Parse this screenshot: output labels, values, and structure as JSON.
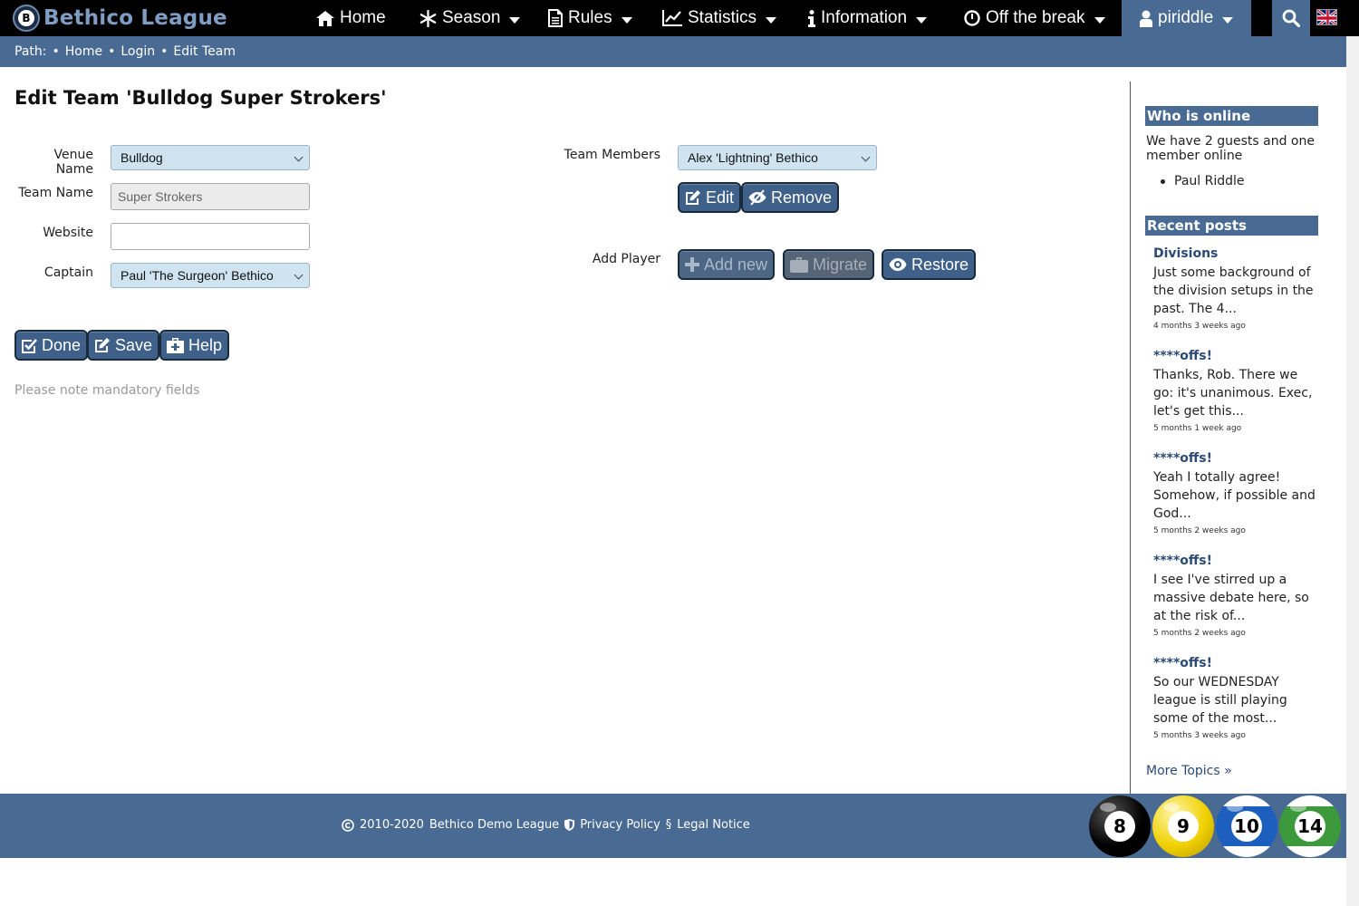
{
  "brand": {
    "name": "Bethico League",
    "ball_letter": "B"
  },
  "nav": {
    "home": "Home",
    "season": "Season",
    "rules": "Rules",
    "statistics": "Statistics",
    "information": "Information",
    "off_the_break": "Off the break",
    "user": "piriddle"
  },
  "breadcrumb": {
    "label": "Path:",
    "items": [
      "Home",
      "Login",
      "Edit Team"
    ],
    "separator": "•"
  },
  "page": {
    "title": "Edit Team 'Bulldog Super Strokers'",
    "note": "Please note mandatory fields"
  },
  "form": {
    "venue_label": "Venue Name",
    "venue_value": "Bulldog",
    "team_label": "Team Name",
    "team_value": "Super Strokers",
    "website_label": "Website",
    "website_value": "",
    "captain_label": "Captain",
    "captain_value": "Paul 'The Surgeon' Bethico",
    "members_label": "Team Members",
    "members_value": "Alex 'Lightning' Bethico",
    "add_player_label": "Add Player"
  },
  "buttons": {
    "edit": "Edit",
    "remove": "Remove",
    "add_new": "Add new",
    "migrate": "Migrate",
    "restore": "Restore",
    "done": "Done",
    "save": "Save",
    "help": "Help"
  },
  "sidebar": {
    "online_title": "Who is online",
    "online_text": "We have 2 guests and one member online",
    "online_members": [
      "Paul Riddle"
    ],
    "posts_title": "Recent posts",
    "posts": [
      {
        "title": "Divisions",
        "body": "Just some background of the division setups in the past. The 4...",
        "time": "4 months 3 weeks ago"
      },
      {
        "title": "****offs!",
        "body": "Thanks, Rob. There we go: it's unanimous. Exec, let's get this...",
        "time": "5 months 1 week ago"
      },
      {
        "title": "****offs!",
        "body": "Yeah I totally agree! Somehow, if possible and God...",
        "time": "5 months 2 weeks ago"
      },
      {
        "title": "****offs!",
        "body": "I see I've stirred up a massive debate here, so at the risk of...",
        "time": "5 months 2 weeks ago"
      },
      {
        "title": "****offs!",
        "body": "So our WEDNESDAY league is still playing some of the most...",
        "time": "5 months 3 weeks ago"
      }
    ],
    "more_topics": "More Topics »"
  },
  "footer": {
    "years": "2010-2020",
    "league": "Bethico Demo League",
    "privacy": "Privacy Policy",
    "legal": "Legal Notice",
    "balls": [
      "8",
      "9",
      "10",
      "14"
    ]
  },
  "colors": {
    "header_bg": "#000000",
    "accent": "#496b93",
    "button": "#3e6089",
    "select_bg": "#cfe4f0",
    "link": "#2a4a75"
  }
}
